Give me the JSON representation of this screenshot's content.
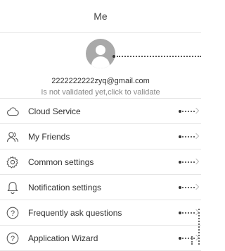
{
  "header": {
    "title": "Me"
  },
  "profile": {
    "email": "2222222222zyq@gmail.com",
    "validation_hint": "Is not validated yet,click to validate"
  },
  "menu": {
    "items": [
      {
        "label": "Cloud Service",
        "icon": "cloud-icon"
      },
      {
        "label": "My Friends",
        "icon": "friends-icon"
      },
      {
        "label": "Common settings",
        "icon": "gear-icon"
      },
      {
        "label": "Notification settings",
        "icon": "bell-icon"
      },
      {
        "label": "Frequently ask questions",
        "icon": "question-icon"
      },
      {
        "label": "Application Wizard",
        "icon": "question-icon"
      }
    ]
  }
}
